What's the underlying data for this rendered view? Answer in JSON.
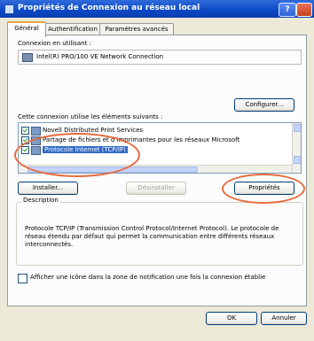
{
  "window": {
    "title": "Propriétés de Connexion au réseau local"
  },
  "tabs": [
    {
      "label": "Général"
    },
    {
      "label": "Authentification"
    },
    {
      "label": "Paramètres avancés"
    }
  ],
  "general": {
    "connect_using_label": "Connexion en utilisant :",
    "adapter_name": "Intel(R) PRO/100 VE Network Connection",
    "configure_button": "Configurer...",
    "components_label": "Cette connexion utilise les éléments suivants :",
    "components": [
      {
        "label": "Novell Distributed Print Services",
        "checked": true,
        "selected": false
      },
      {
        "label": "Partage de fichiers et d'imprimantes pour les réseaux Microsoft",
        "checked": true,
        "selected": false
      },
      {
        "label": "Protocole Internet (TCP/IP)",
        "checked": true,
        "selected": true
      }
    ],
    "install_button": "Installer...",
    "uninstall_button": "Désinstaller",
    "properties_button": "Propriétés",
    "description_title": "Description",
    "description_text": "Protocole TCP/IP (Transmission Control Protocol/Internet Protocol). Le protocole de réseau étendu par défaut qui permet la communication entre différents réseaux interconnectés.",
    "notify_checkbox_label": "Afficher une icône dans la zone de notification une fois la connexion établie"
  },
  "footer": {
    "ok_button": "OK",
    "cancel_button": "Annuler"
  },
  "colors": {
    "titlebar": "#0b49c6",
    "selection": "#316ac5",
    "annotation_circle": "#e86a3a"
  }
}
